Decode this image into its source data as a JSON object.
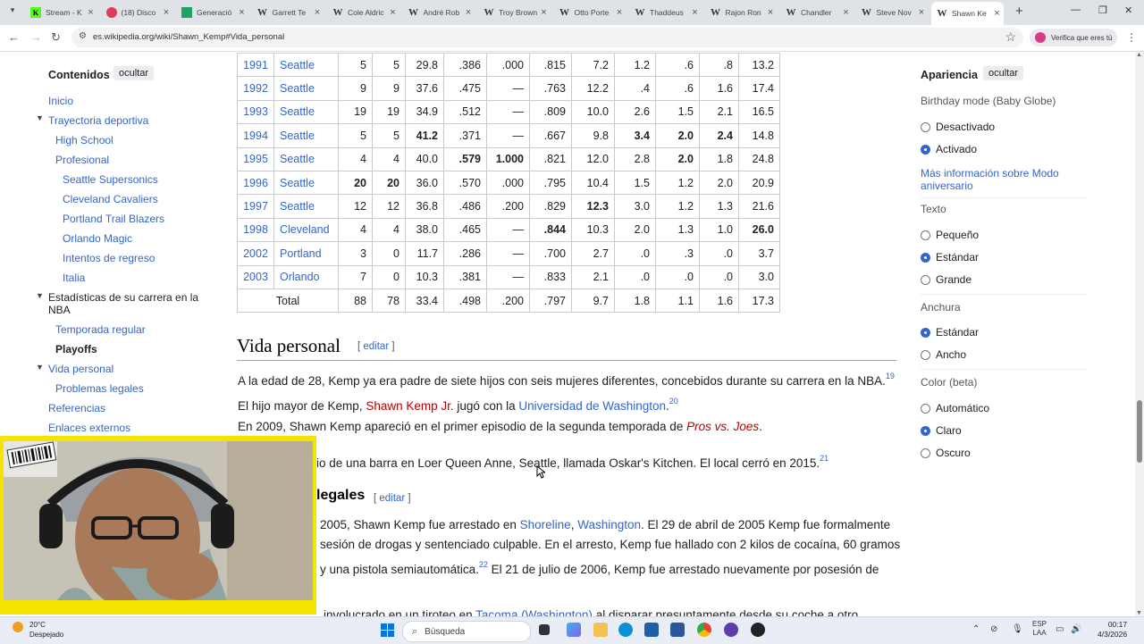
{
  "browser": {
    "tabs": [
      {
        "label": "Stream - K",
        "icon": "kick-icon"
      },
      {
        "label": "(18) Disco",
        "icon": "discord-icon"
      },
      {
        "label": "Generació",
        "icon": "sheets-icon"
      },
      {
        "label": "Garrett Te",
        "icon": "wikipedia-icon"
      },
      {
        "label": "Cole Aldric",
        "icon": "wikipedia-icon"
      },
      {
        "label": "André Rob",
        "icon": "wikipedia-icon"
      },
      {
        "label": "Troy Brown",
        "icon": "wikipedia-icon"
      },
      {
        "label": "Otto Porte",
        "icon": "wikipedia-icon"
      },
      {
        "label": "Thaddeus",
        "icon": "wikipedia-icon"
      },
      {
        "label": "Rajon Ron",
        "icon": "wikipedia-icon"
      },
      {
        "label": "Chandler",
        "icon": "wikipedia-icon"
      },
      {
        "label": "Steve Nov",
        "icon": "wikipedia-icon"
      },
      {
        "label": "Shawn Ke",
        "icon": "wikipedia-icon"
      }
    ],
    "url": "es.wikipedia.org/wiki/Shawn_Kemp#Vida_personal",
    "profile_label": "Verifica que eres tú"
  },
  "toc": {
    "title": "Contenidos",
    "hide": "ocultar",
    "items": [
      {
        "label": "Inicio"
      },
      {
        "label": "Trayectoria deportiva"
      },
      {
        "label": "High School"
      },
      {
        "label": "Profesional"
      },
      {
        "label": "Seattle Supersonics"
      },
      {
        "label": "Cleveland Cavaliers"
      },
      {
        "label": "Portland Trail Blazers"
      },
      {
        "label": "Orlando Magic"
      },
      {
        "label": "Intentos de regreso"
      },
      {
        "label": "Italia"
      },
      {
        "label": "Estadísticas de su carrera en la"
      },
      {
        "label": "NBA"
      },
      {
        "label": "Temporada regular"
      },
      {
        "label": "Playoffs"
      },
      {
        "label": "Vida personal"
      },
      {
        "label": "Problemas legales"
      },
      {
        "label": "Referencias"
      },
      {
        "label": "Enlaces externos"
      }
    ]
  },
  "stats": {
    "rows": [
      [
        "1991",
        "Seattle",
        "5",
        "5",
        "29.8",
        ".386",
        ".000",
        ".815",
        "7.2",
        "1.2",
        ".6",
        ".8",
        "13.2"
      ],
      [
        "1992",
        "Seattle",
        "9",
        "9",
        "37.6",
        ".475",
        "—",
        ".763",
        "12.2",
        ".4",
        ".6",
        "1.6",
        "17.4"
      ],
      [
        "1993",
        "Seattle",
        "19",
        "19",
        "34.9",
        ".512",
        "—",
        ".809",
        "10.0",
        "2.6",
        "1.5",
        "2.1",
        "16.5"
      ],
      [
        "1994",
        "Seattle",
        "5",
        "5",
        "41.2",
        ".371",
        "—",
        ".667",
        "9.8",
        "3.4",
        "2.0",
        "2.4",
        "14.8"
      ],
      [
        "1995",
        "Seattle",
        "4",
        "4",
        "40.0",
        ".579",
        "1.000",
        ".821",
        "12.0",
        "2.8",
        "2.0",
        "1.8",
        "24.8"
      ],
      [
        "1996",
        "Seattle",
        "20",
        "20",
        "36.0",
        ".570",
        ".000",
        ".795",
        "10.4",
        "1.5",
        "1.2",
        "2.0",
        "20.9"
      ],
      [
        "1997",
        "Seattle",
        "12",
        "12",
        "36.8",
        ".486",
        ".200",
        ".829",
        "12.3",
        "3.0",
        "1.2",
        "1.3",
        "21.6"
      ],
      [
        "1998",
        "Cleveland",
        "4",
        "4",
        "38.0",
        ".465",
        "—",
        ".844",
        "10.3",
        "2.0",
        "1.3",
        "1.0",
        "26.0"
      ],
      [
        "2002",
        "Portland",
        "3",
        "0",
        "11.7",
        ".286",
        "—",
        ".700",
        "2.7",
        ".0",
        ".3",
        ".0",
        "3.7"
      ],
      [
        "2003",
        "Orlando",
        "7",
        "0",
        "10.3",
        ".381",
        "—",
        ".833",
        "2.1",
        ".0",
        ".0",
        ".0",
        "3.0"
      ]
    ],
    "total": [
      "Total",
      "88",
      "78",
      "33.4",
      ".498",
      ".200",
      ".797",
      "9.7",
      "1.8",
      "1.1",
      "1.6",
      "17.3"
    ]
  },
  "vida": {
    "title": "Vida personal",
    "edit": "editar",
    "p1a": "A la edad de 28, Kemp ya era padre de siete hijos con seis mujeres diferentes, concebidos durante su carrera en la NBA.",
    "p1ref": "19",
    "p1b": "El hijo mayor de Kemp, ",
    "p1link1": "Shawn Kemp Jr.",
    "p1c": " jugó con la ",
    "p1link2": "Universidad de Washington",
    "p1d": ".",
    "p1ref2": "20",
    "p2a": "En 2009, Shawn Kemp apareció en el primer episodio de la segunda temporada de ",
    "p2link": "Pros vs. Joes",
    "p2b": ".",
    "p3": "io de una barra en Loer Queen Anne, Seattle, llamada Oskar's Kitchen. El local cerró en 2015.",
    "p3ref": "21"
  },
  "legal": {
    "title": "legales",
    "edit": "editar",
    "l1a": "2005, Shawn Kemp fue arrestado en ",
    "l1link1": "Shoreline",
    "l1sep": ", ",
    "l1link2": "Washington",
    "l1b": ". El 29 de abril de 2005 Kemp fue formalmente",
    "l2": "sesión de drogas y sentenciado culpable. En el arresto, Kemp fue hallado con 2 kilos de cocaína, 60 gramos",
    "l3a": "y una pistola semiautomática.",
    "l3ref": "22",
    "l3b": " El 21 de julio de 2006, Kemp fue arrestado nuevamente por posesión de",
    "l4a": "involucrado en un tiroteo en ",
    "l4link": "Tacoma (Washington)",
    "l4b": " al disparar presuntamente desde su coche a otro"
  },
  "appearance": {
    "title": "Apariencia",
    "hide": "ocultar",
    "birthday_label": "Birthday mode (Baby Globe)",
    "birthday_off": "Desactivado",
    "birthday_on": "Activado",
    "more_link": "Más información sobre Modo aniversario",
    "text_label": "Texto",
    "text_small": "Pequeño",
    "text_standard": "Estándar",
    "text_large": "Grande",
    "width_label": "Anchura",
    "width_standard": "Estándar",
    "width_wide": "Ancho",
    "color_label": "Color (beta)",
    "color_auto": "Automático",
    "color_light": "Claro",
    "color_dark": "Oscuro"
  },
  "taskbar": {
    "temp": "20°C",
    "weather": "Despejado",
    "search": "Búsqueda",
    "lang1": "ESP",
    "lang2": "LAA",
    "time": "00:17",
    "date": "4/3/2026"
  }
}
